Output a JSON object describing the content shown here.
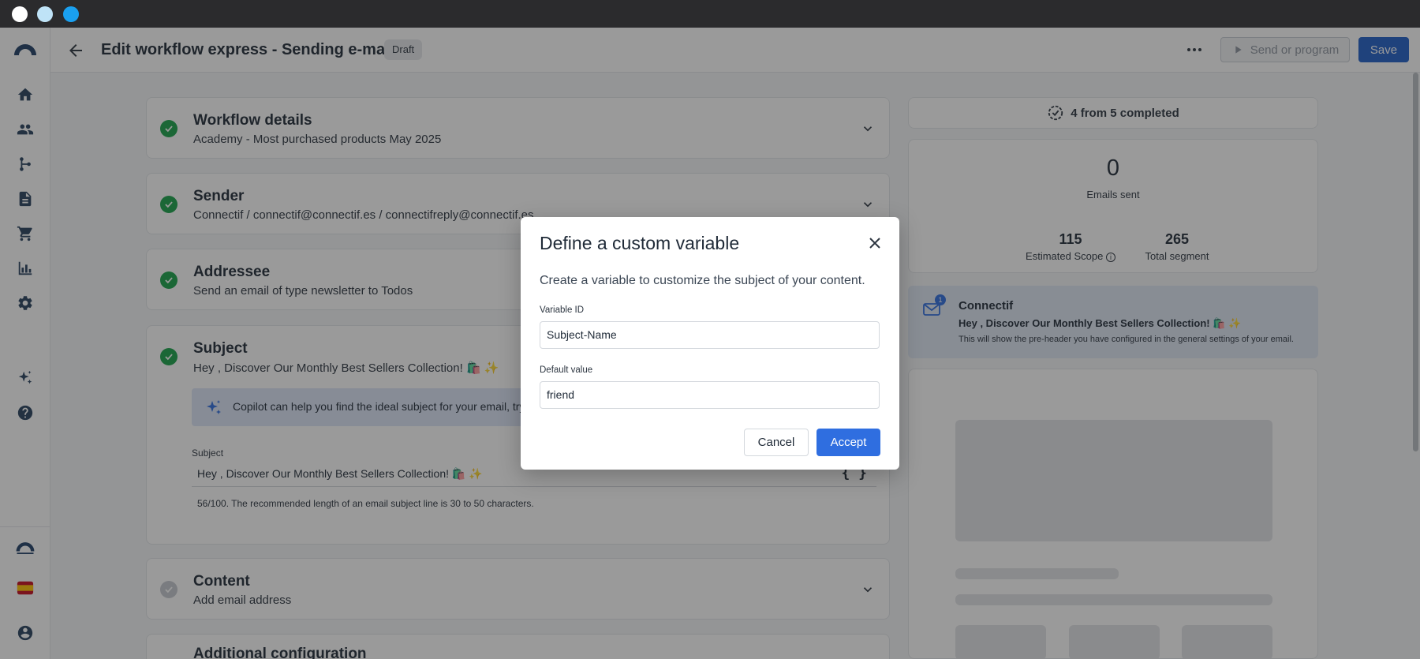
{
  "window": {
    "traffic_lights": [
      "#ffffff",
      "#bfe3f7",
      "#1aa0f0"
    ]
  },
  "header": {
    "title": "Edit workflow express - Sending e-mails",
    "status": "Draft",
    "send_label": "Send or program",
    "save_label": "Save"
  },
  "sidebar": {
    "items": [
      "logo-icon",
      "home-icon",
      "contacts-icon",
      "workflow-icon",
      "document-icon",
      "cart-icon",
      "analytics-icon",
      "settings-icon",
      "copilot-icon",
      "help-icon",
      "brand-icon",
      "spain-flag-icon",
      "user-icon"
    ]
  },
  "steps": [
    {
      "title": "Workflow details",
      "subtitle": "Academy - Most purchased products May 2025",
      "done": true
    },
    {
      "title": "Sender",
      "subtitle": "Connectif / connectif@connectif.es / connectifreply@connectif.es",
      "done": true
    },
    {
      "title": "Addressee",
      "subtitle": "Send an email of type newsletter to Todos",
      "done": true
    },
    {
      "title": "Subject",
      "subtitle": "Hey , Discover Our Monthly Best Sellers Collection! 🛍️ ✨",
      "done": true
    },
    {
      "title": "Content",
      "subtitle": "Add email address",
      "done": false
    },
    {
      "title": "Additional configuration",
      "subtitle": "",
      "done": false
    }
  ],
  "subject": {
    "copilot_text": "Copilot can help you find the ideal subject for your email, try it o",
    "label": "Subject",
    "value": "Hey , Discover Our Monthly Best Sellers Collection! 🛍️ ✨",
    "variable_button": "{ }",
    "hint": "56/100. The recommended length of an email subject line is 30 to 50 characters."
  },
  "summary": {
    "progress": "4 from 5 completed",
    "emails_sent": "0",
    "emails_sent_label": "Emails sent",
    "estimated_scope": "115",
    "estimated_scope_label": "Estimated Scope",
    "total_segment": "265",
    "total_segment_label": "Total segment"
  },
  "preview": {
    "badge": "1",
    "sender": "Connectif",
    "subject": "Hey , Discover Our Monthly Best Sellers Collection! 🛍️ ✨",
    "preheader": "This will show the pre-header you have configured in the general settings of your email."
  },
  "modal": {
    "title": "Define a custom variable",
    "description": "Create a variable to customize the subject of your content.",
    "variable_id_label": "Variable ID",
    "variable_id_value": "Subject-Name",
    "default_value_label": "Default value",
    "default_value_value": "friend",
    "cancel_label": "Cancel",
    "accept_label": "Accept"
  },
  "colors": {
    "primary": "#2f6ee0",
    "success": "#18a34a",
    "navy": "#27415e"
  }
}
